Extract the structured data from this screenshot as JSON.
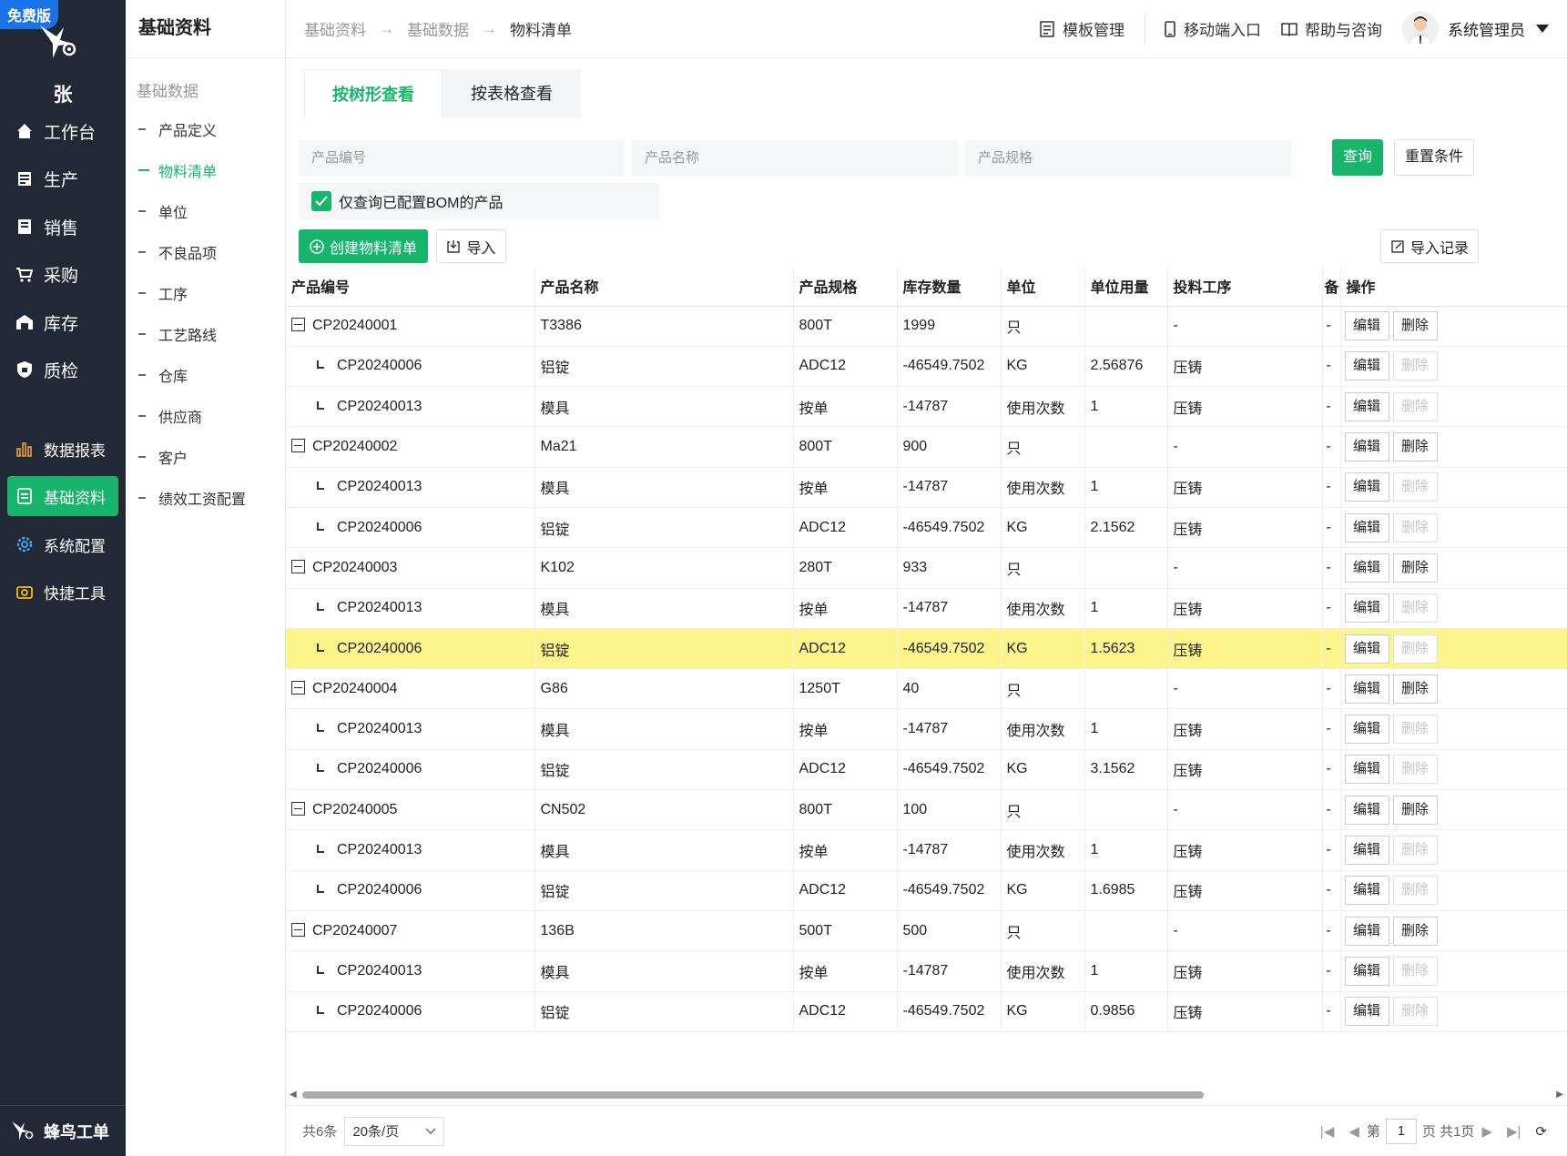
{
  "badge": "免费版",
  "user_initial": "张",
  "nav": {
    "items": [
      {
        "label": "工作台",
        "icon": "home-icon"
      },
      {
        "label": "生产",
        "icon": "production-icon"
      },
      {
        "label": "销售",
        "icon": "sales-icon"
      },
      {
        "label": "采购",
        "icon": "cart-icon"
      },
      {
        "label": "库存",
        "icon": "warehouse-icon"
      },
      {
        "label": "质检",
        "icon": "shield-icon"
      },
      {
        "label": "数据报表",
        "icon": "bar-chart-icon"
      },
      {
        "label": "基础资料",
        "icon": "document-icon"
      },
      {
        "label": "系统配置",
        "icon": "gear-icon"
      },
      {
        "label": "快捷工具",
        "icon": "tool-icon"
      }
    ],
    "footer": "蜂鸟工单"
  },
  "subnav": {
    "title": "基础资料",
    "group": "基础数据",
    "items": [
      "产品定义",
      "物料清单",
      "单位",
      "不良品项",
      "工序",
      "工艺路线",
      "仓库",
      "供应商",
      "客户",
      "绩效工资配置"
    ]
  },
  "header": {
    "crumbs": [
      "基础资料",
      "基础数据",
      "物料清单"
    ],
    "template": "模板管理",
    "mobile": "移动端入口",
    "help": "帮助与咨询",
    "user": "系统管理员"
  },
  "tabs": [
    "按树形查看",
    "按表格查看"
  ],
  "filter": {
    "code_placeholder": "产品编号",
    "name_placeholder": "产品名称",
    "spec_placeholder": "产品规格",
    "query": "查询",
    "reset": "重置条件",
    "only_bom": "仅查询已配置BOM的产品"
  },
  "actions": {
    "create": "创建物料清单",
    "import": "导入",
    "records": "导入记录"
  },
  "table": {
    "columns": [
      "产品编号",
      "产品名称",
      "产品规格",
      "库存数量",
      "单位",
      "单位用量",
      "投料工序",
      "备",
      "操作"
    ],
    "edit": "编辑",
    "delete": "删除",
    "rows": [
      {
        "level": 0,
        "code": "CP20240001",
        "name": "T3386",
        "spec": "800T",
        "stock": "1999",
        "unit": "只",
        "usage": "",
        "process": "-",
        "note": "-"
      },
      {
        "level": 1,
        "code": "CP20240006",
        "name": "铝锭",
        "spec": "ADC12",
        "stock": "-46549.7502",
        "unit": "KG",
        "usage": "2.56876",
        "process": "压铸",
        "note": "-"
      },
      {
        "level": 1,
        "code": "CP20240013",
        "name": "模具",
        "spec": "按单",
        "stock": "-14787",
        "unit": "使用次数",
        "usage": "1",
        "process": "压铸",
        "note": "-"
      },
      {
        "level": 0,
        "code": "CP20240002",
        "name": "Ma21",
        "spec": "800T",
        "stock": "900",
        "unit": "只",
        "usage": "",
        "process": "-",
        "note": "-"
      },
      {
        "level": 1,
        "code": "CP20240013",
        "name": "模具",
        "spec": "按单",
        "stock": "-14787",
        "unit": "使用次数",
        "usage": "1",
        "process": "压铸",
        "note": "-"
      },
      {
        "level": 1,
        "code": "CP20240006",
        "name": "铝锭",
        "spec": "ADC12",
        "stock": "-46549.7502",
        "unit": "KG",
        "usage": "2.1562",
        "process": "压铸",
        "note": "-"
      },
      {
        "level": 0,
        "code": "CP20240003",
        "name": "K102",
        "spec": "280T",
        "stock": "933",
        "unit": "只",
        "usage": "",
        "process": "-",
        "note": "-"
      },
      {
        "level": 1,
        "code": "CP20240013",
        "name": "模具",
        "spec": "按单",
        "stock": "-14787",
        "unit": "使用次数",
        "usage": "1",
        "process": "压铸",
        "note": "-"
      },
      {
        "level": 1,
        "code": "CP20240006",
        "name": "铝锭",
        "spec": "ADC12",
        "stock": "-46549.7502",
        "unit": "KG",
        "usage": "1.5623",
        "process": "压铸",
        "note": "-",
        "highlight": true
      },
      {
        "level": 0,
        "code": "CP20240004",
        "name": "G86",
        "spec": "1250T",
        "stock": "40",
        "unit": "只",
        "usage": "",
        "process": "-",
        "note": "-"
      },
      {
        "level": 1,
        "code": "CP20240013",
        "name": "模具",
        "spec": "按单",
        "stock": "-14787",
        "unit": "使用次数",
        "usage": "1",
        "process": "压铸",
        "note": "-"
      },
      {
        "level": 1,
        "code": "CP20240006",
        "name": "铝锭",
        "spec": "ADC12",
        "stock": "-46549.7502",
        "unit": "KG",
        "usage": "3.1562",
        "process": "压铸",
        "note": "-"
      },
      {
        "level": 0,
        "code": "CP20240005",
        "name": "CN502",
        "spec": "800T",
        "stock": "100",
        "unit": "只",
        "usage": "",
        "process": "-",
        "note": "-"
      },
      {
        "level": 1,
        "code": "CP20240013",
        "name": "模具",
        "spec": "按单",
        "stock": "-14787",
        "unit": "使用次数",
        "usage": "1",
        "process": "压铸",
        "note": "-"
      },
      {
        "level": 1,
        "code": "CP20240006",
        "name": "铝锭",
        "spec": "ADC12",
        "stock": "-46549.7502",
        "unit": "KG",
        "usage": "1.6985",
        "process": "压铸",
        "note": "-"
      },
      {
        "level": 0,
        "code": "CP20240007",
        "name": "136B",
        "spec": "500T",
        "stock": "500",
        "unit": "只",
        "usage": "",
        "process": "-",
        "note": "-"
      },
      {
        "level": 1,
        "code": "CP20240013",
        "name": "模具",
        "spec": "按单",
        "stock": "-14787",
        "unit": "使用次数",
        "usage": "1",
        "process": "压铸",
        "note": "-"
      },
      {
        "level": 1,
        "code": "CP20240006",
        "name": "铝锭",
        "spec": "ADC12",
        "stock": "-46549.7502",
        "unit": "KG",
        "usage": "0.9856",
        "process": "压铸",
        "note": "-"
      }
    ]
  },
  "pager": {
    "total": "共6条",
    "size": "20条/页",
    "page_prefix": "第",
    "page": "1",
    "page_suffix": "页 共1页"
  },
  "colors": {
    "accent": "#16b56b",
    "nav_bg": "#212836",
    "highlight": "#fbf58a",
    "badge": "#1a73e8"
  }
}
